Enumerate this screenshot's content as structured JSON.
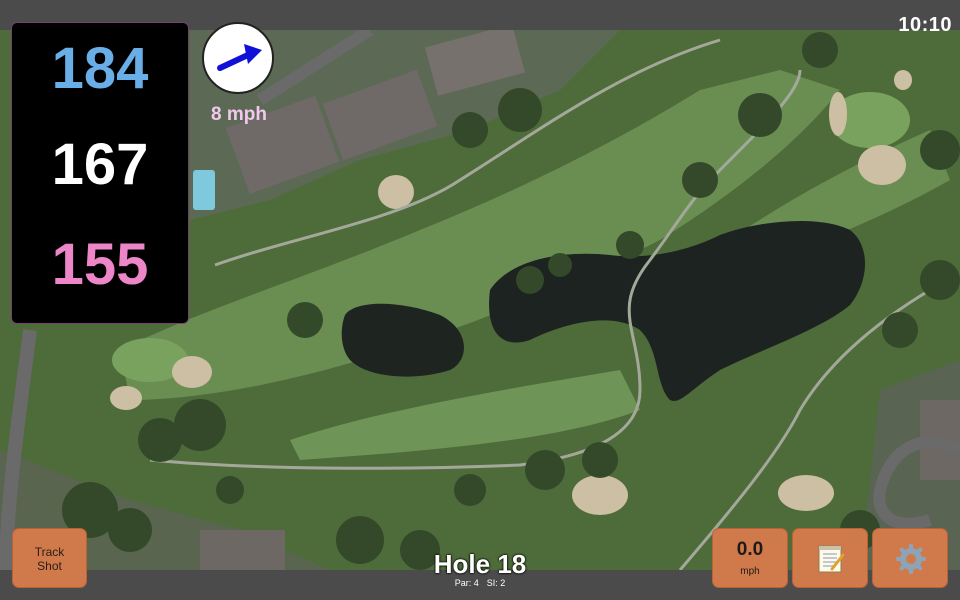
{
  "status": {
    "time": "10:10"
  },
  "distances": {
    "back": "184",
    "middle": "167",
    "front": "155"
  },
  "wind": {
    "speed_label": "8 mph",
    "direction_icon": "arrow-northeast-icon"
  },
  "buttons": {
    "track_shot": "Track\nShot",
    "speed_value": "0.0",
    "speed_unit": "mph",
    "notes_icon": "notepad-icon",
    "settings_icon": "gear-icon"
  },
  "hole": {
    "title": "Hole 18",
    "par": "Par: 4",
    "si": "SI: 2"
  },
  "colors": {
    "back_tee": "#6aaee8",
    "middle_tee": "#ffffff",
    "front_tee": "#ec86c8",
    "button_bg": "#d07a4b",
    "wind_label": "#f2c8ee"
  }
}
